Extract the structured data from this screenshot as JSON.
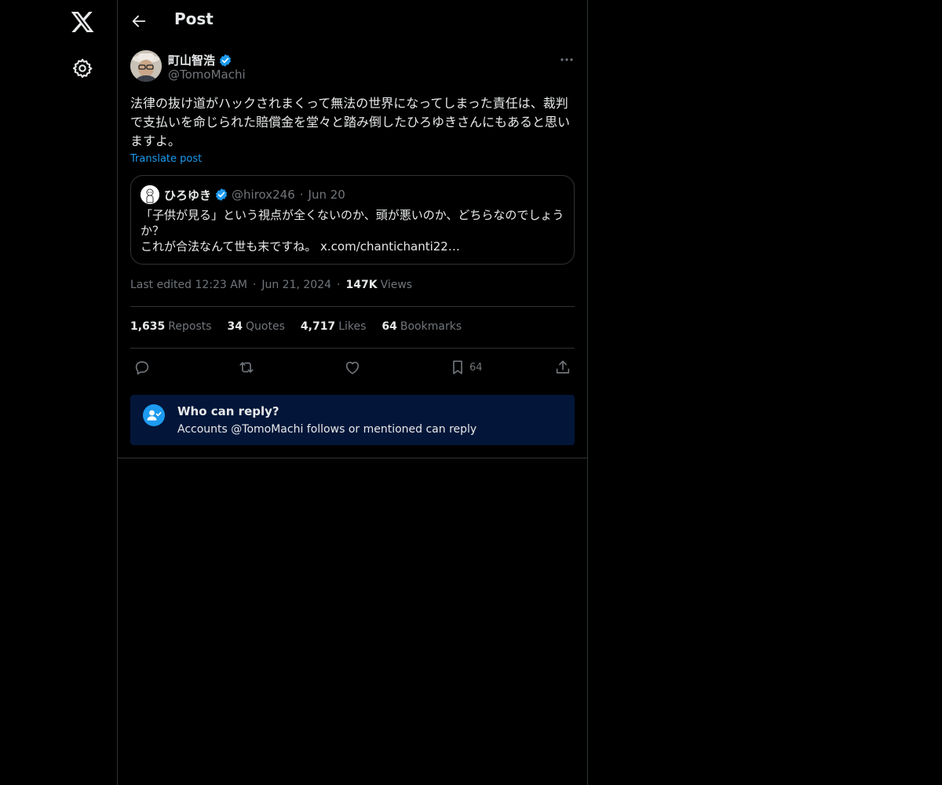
{
  "header": {
    "title": "Post"
  },
  "post": {
    "author_name": "町山智浩",
    "handle": "@TomoMachi",
    "text": "法律の抜け道がハックされまくって無法の世界になってしまった責任は、裁判で支払いを命じられた賠償金を堂々と踏み倒したひろゆきさんにもあると思いますよ。",
    "translate_label": "Translate post",
    "quote": {
      "author_name": "ひろゆき",
      "handle": "@hirox246",
      "date": "Jun 20",
      "line1": "「子供が見る」という視点が全くないのか、頭が悪いのか、どちらなのでしょうか？",
      "line2": "これが合法なんて世も末ですね。 x.com/chantichanti22…"
    },
    "meta": {
      "edited": "Last edited 12:23 AM",
      "date": "Jun 21, 2024",
      "views_count": "147K",
      "views_label": "Views"
    },
    "stats": {
      "reposts_count": "1,635",
      "reposts_label": "Reposts",
      "quotes_count": "34",
      "quotes_label": "Quotes",
      "likes_count": "4,717",
      "likes_label": "Likes",
      "bookmarks_count": "64",
      "bookmarks_label": "Bookmarks"
    },
    "actions": {
      "bookmark_count": "64"
    },
    "reply_info": {
      "title": "Who can reply?",
      "description": "Accounts @TomoMachi follows or mentioned can reply"
    }
  },
  "icons": [
    "x-logo-icon",
    "settings-icon",
    "back-arrow-icon",
    "verified-icon",
    "more-icon",
    "reply-icon",
    "repost-icon",
    "like-icon",
    "bookmark-icon",
    "share-icon",
    "reply-restriction-icon"
  ],
  "colors": {
    "background": "#000000",
    "text": "#e7e9ea",
    "muted": "#71767b",
    "accent": "#1d9bf0",
    "border": "#2f3336",
    "info_box": "#031639"
  }
}
